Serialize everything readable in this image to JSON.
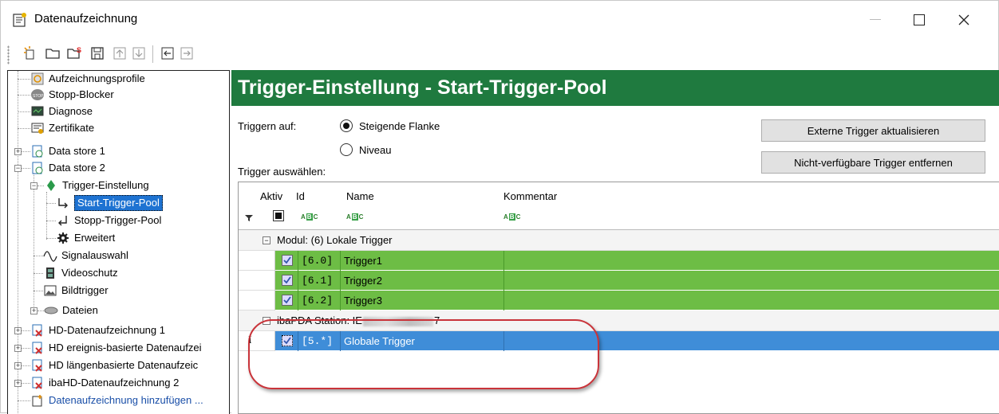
{
  "window": {
    "title": "Datenaufzeichnung"
  },
  "tree": {
    "items": [
      {
        "label": "Aufzeichnungsprofile"
      },
      {
        "label": "Stopp-Blocker"
      },
      {
        "label": "Diagnose"
      },
      {
        "label": "Zertifikate"
      },
      {
        "label": "Data store 1"
      },
      {
        "label": "Data store 2"
      },
      {
        "label": "Trigger-Einstellung"
      },
      {
        "label": "Start-Trigger-Pool"
      },
      {
        "label": "Stopp-Trigger-Pool"
      },
      {
        "label": "Erweitert"
      },
      {
        "label": "Signalauswahl"
      },
      {
        "label": "Videoschutz"
      },
      {
        "label": "Bildtrigger"
      },
      {
        "label": "Dateien"
      },
      {
        "label": "HD-Datenaufzeichnung 1"
      },
      {
        "label": "HD ereignis-basierte Datenaufzei"
      },
      {
        "label": "HD längenbasierte Datenaufzeic"
      },
      {
        "label": "ibaHD-Datenaufzeichnung 2"
      },
      {
        "label": "Datenaufzeichnung hinzufügen ..."
      }
    ]
  },
  "panel": {
    "title": "Trigger-Einstellung - Start-Trigger-Pool",
    "trigger_on_label": "Triggern auf:",
    "radio_rising": "Steigende Flanke",
    "radio_level": "Niveau",
    "select_trigger_label": "Trigger auswählen:",
    "btn_update": "Externe Trigger aktualisieren",
    "btn_remove": "Nicht-verfügbare Trigger entfernen"
  },
  "grid": {
    "columns": {
      "active": "Aktiv",
      "id": "Id",
      "name": "Name",
      "comment": "Kommentar"
    },
    "abc_icon": "ABC",
    "groups": [
      {
        "label": "Modul: (6) Lokale Trigger",
        "rows": [
          {
            "id": "[6.0]",
            "name": "Trigger1",
            "checked": true
          },
          {
            "id": "[6.1]",
            "name": "Trigger2",
            "checked": true
          },
          {
            "id": "[6.2]",
            "name": "Trigger3",
            "checked": true
          }
        ]
      },
      {
        "label_prefix": "ibaPDA Station: IE",
        "label_suffix": "7",
        "rows": [
          {
            "id": "[5.*]",
            "name": "Globale Trigger",
            "checked": true,
            "selected": true
          }
        ]
      }
    ]
  },
  "colors": {
    "header": "#1f7a3f",
    "row_green": "#6dbd45",
    "row_selected": "#3f8dd8",
    "annotation": "#c9343a"
  }
}
